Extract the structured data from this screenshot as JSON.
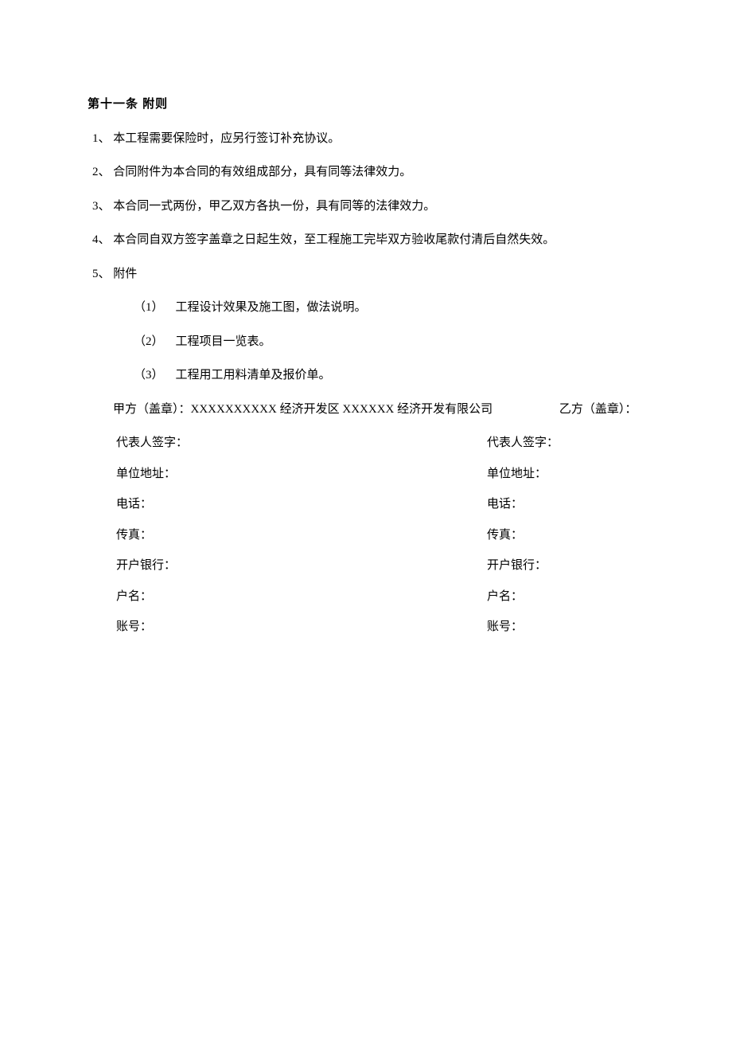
{
  "heading": "第十一条  附则",
  "items": [
    {
      "num": "1、",
      "text": "本工程需要保险时，应另行签订补充协议。"
    },
    {
      "num": "2、",
      "text": "合同附件为本合同的有效组成部分，具有同等法律效力。"
    },
    {
      "num": "3、",
      "text": "本合同一式两份，甲乙双方各执一份，具有同等的法律效力。"
    },
    {
      "num": "4、",
      "text": "本合同自双方签字盖章之日起生效，至工程施工完毕双方验收尾款付清后自然失效。"
    },
    {
      "num": "5、",
      "text": "附件"
    }
  ],
  "subitems": [
    {
      "num": "（1）",
      "text": "工程设计效果及施工图，做法说明。"
    },
    {
      "num": "（2）",
      "text": "工程项目一览表。"
    },
    {
      "num": "（3）",
      "text": "工程用工用料清单及报价单。"
    }
  ],
  "party_a": {
    "label_prefix": "甲方（盖章）：",
    "xs1": "XXXXXXXXXX",
    "mid": " 经济开发区 ",
    "xs2": "XXXXXX",
    "suffix": " 经济开发有限公司"
  },
  "party_b_label": "乙方（盖章）：",
  "fields": [
    "代表人签字：",
    "单位地址：",
    "电话：",
    "传真：",
    "开户银行：",
    "户名：",
    "账号："
  ]
}
